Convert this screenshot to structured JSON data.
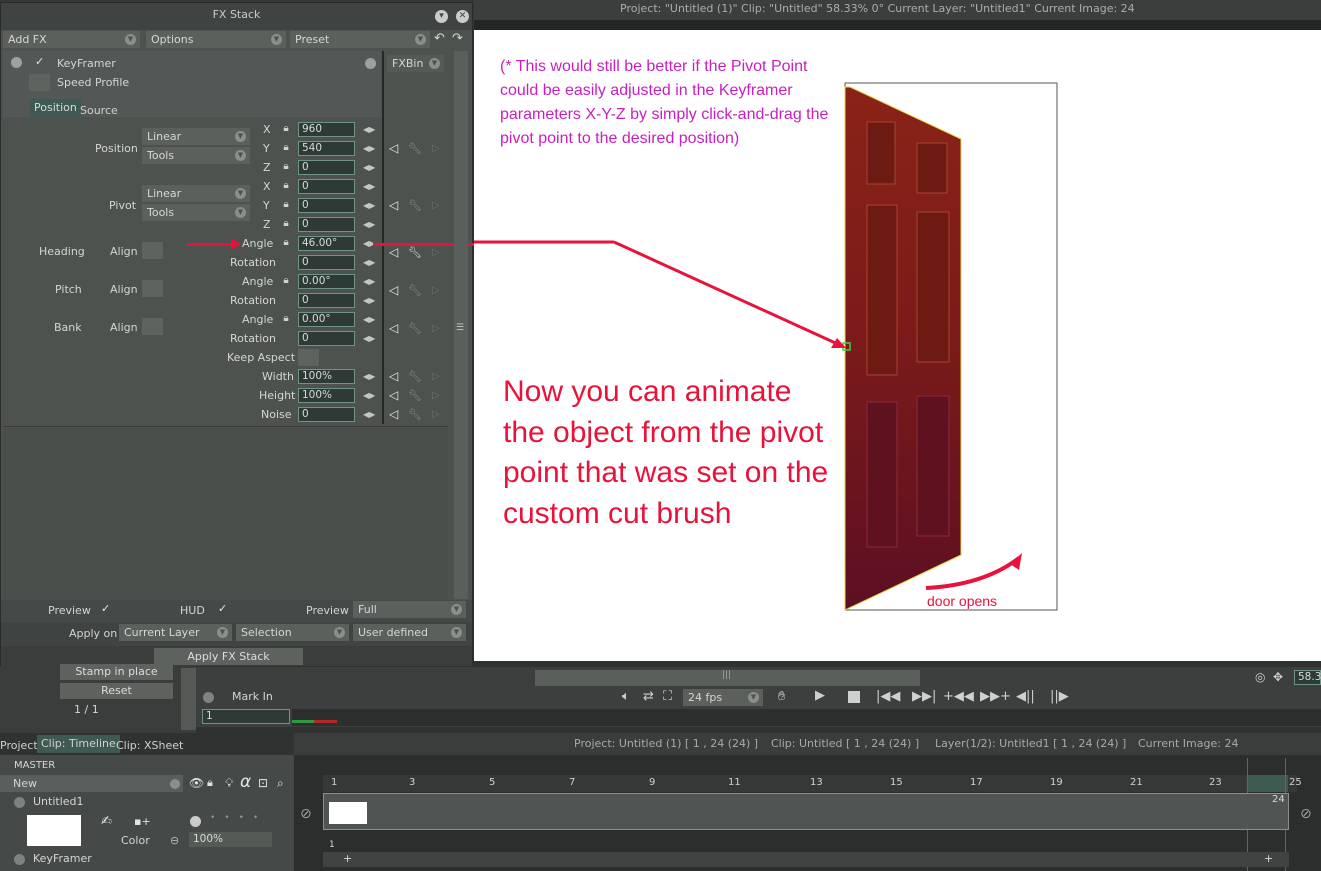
{
  "topbar": {
    "status": "Project:  \"Untitled (1)\"  Clip: \"Untitled\"   58.33%   0°  Current Layer: \"Untitled1\"  Current Image: 24"
  },
  "fx_stack": {
    "title": "FX Stack",
    "toolbar": {
      "add_fx": "Add FX",
      "options": "Options",
      "preset": "Preset"
    },
    "fx_name": "KeyFramer",
    "fxbin": "FXBin",
    "speed_profile": "Speed Profile",
    "tabs": [
      "Position",
      "Source"
    ],
    "position": {
      "label": "Position",
      "interp": "Linear",
      "tools": "Tools",
      "x": "960",
      "y": "540",
      "z": "0"
    },
    "pivot": {
      "label": "Pivot",
      "interp": "Linear",
      "tools": "Tools",
      "x": "0",
      "y": "0",
      "z": "0"
    },
    "axis_labels": [
      "X",
      "Y",
      "Z"
    ],
    "heading": {
      "label": "Heading",
      "align": "Align",
      "angle_label": "Angle",
      "angle": "46.00°",
      "rotation_label": "Rotation",
      "rotation": "0"
    },
    "pitch": {
      "label": "Pitch",
      "align": "Align",
      "angle_label": "Angle",
      "angle": "0.00°",
      "rotation_label": "Rotation",
      "rotation": "0"
    },
    "bank": {
      "label": "Bank",
      "align": "Align",
      "angle_label": "Angle",
      "angle": "0.00°",
      "rotation_label": "Rotation",
      "rotation": "0"
    },
    "keep_aspect": "Keep Aspect",
    "width": {
      "label": "Width",
      "value": "100%"
    },
    "height": {
      "label": "Height",
      "value": "100%"
    },
    "noise": {
      "label": "Noise",
      "value": "0"
    },
    "footer": {
      "preview": "Preview",
      "hud": "HUD",
      "preview2": "Preview",
      "preview_mode": "Full",
      "apply_on": "Apply on",
      "current_layer": "Current Layer",
      "selection": "Selection",
      "user_defined": "User defined",
      "apply_button": "Apply FX Stack"
    }
  },
  "left_buttons": {
    "stamp": "Stamp in place",
    "reset": "Reset",
    "pages": "1 / 1"
  },
  "viewer": {
    "note": "(* This would still be better if the Pivot Point could be easily adjusted in the Keyframer parameters X-Y-Z by simply click-and-drag the pivot point to the desired position)",
    "big_note": "Now you can animate the object from the pivot point that was set on the custom cut brush",
    "door_label": "door opens",
    "zoom": "58.33"
  },
  "transport": {
    "mark_in": "Mark In",
    "mark_in_value": "1",
    "fps": "24 fps"
  },
  "timeline": {
    "tabs": [
      "Project",
      "Clip: Timeline",
      "Clip: XSheet"
    ],
    "header": {
      "project": "Project: Untitled (1) [ 1 , 24  (24) ]",
      "clip": "Clip: Untitled [ 1 , 24  (24) ]",
      "layer": "Layer(1/2): Untitled1 [ 1 , 24  (24) ]",
      "current_image": "Current Image: 24"
    },
    "master": "MASTER",
    "new": "New",
    "layer_name": "Untitled1",
    "color_label": "Color",
    "opacity": "100%",
    "fx_layer": "KeyFramer",
    "ruler": [
      "1",
      "3",
      "5",
      "7",
      "9",
      "11",
      "13",
      "15",
      "17",
      "19",
      "21",
      "23",
      "24",
      "25"
    ],
    "end_frame": "24",
    "start_frame": "1"
  }
}
